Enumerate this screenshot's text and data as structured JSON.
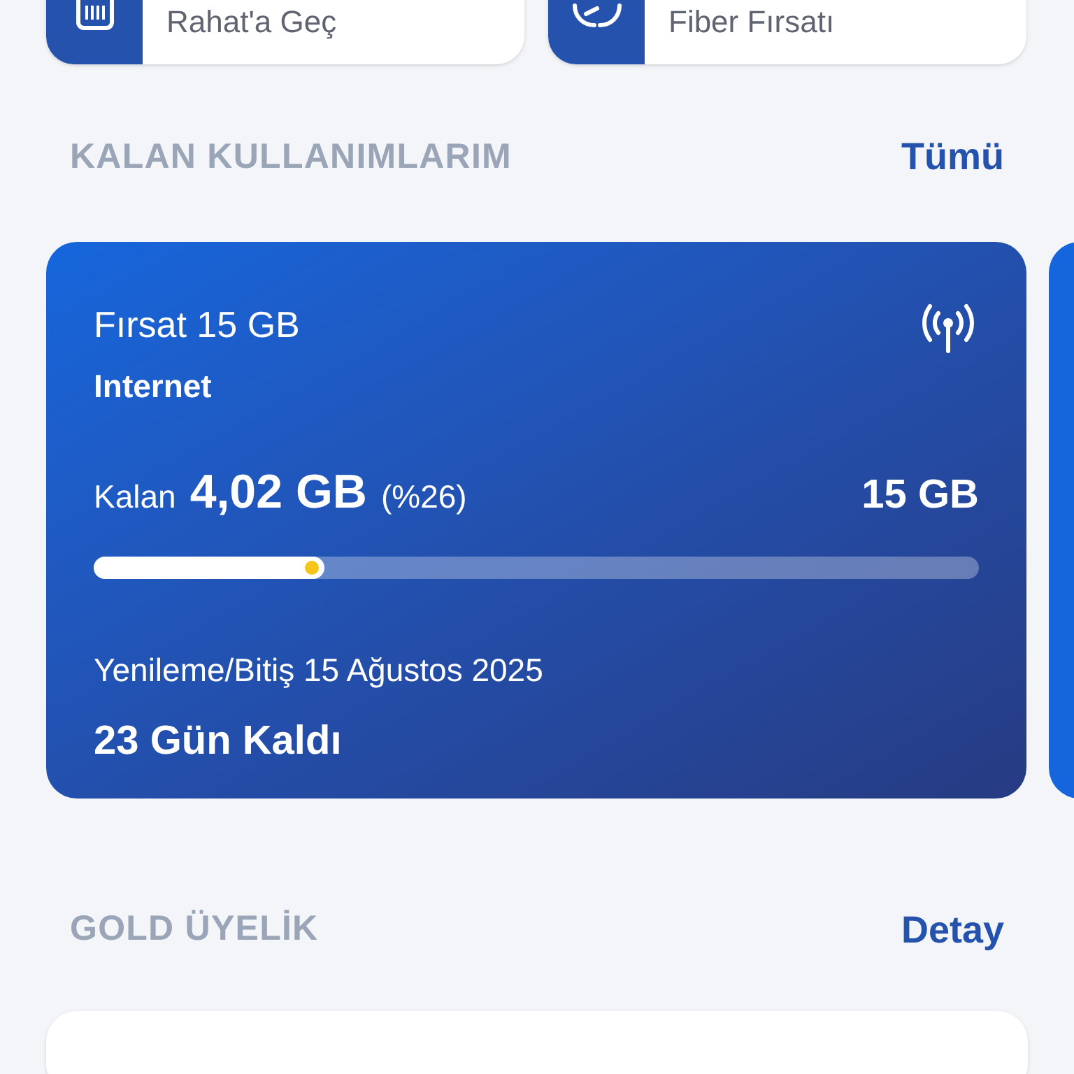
{
  "shortcuts": [
    {
      "kind": "sim",
      "label": "Rahat'a Geç"
    },
    {
      "kind": "fiber",
      "label": "Fiber Fırsatı"
    }
  ],
  "usage_section": {
    "title": "KALAN KULLANIMLARIM",
    "link": "Tümü"
  },
  "usage_card": {
    "package": "Fırsat 15 GB",
    "type": "Internet",
    "remaining_label": "Kalan",
    "remaining": "4,02 GB",
    "percent": "(%26)",
    "total": "15 GB",
    "level": 0.26,
    "renewal": "Yenileme/Bitiş 15 Ağustos 2025",
    "days_left": "23 Gün Kaldı"
  },
  "gold_section": {
    "title": "GOLD ÜYELİK",
    "link": "Detay"
  }
}
